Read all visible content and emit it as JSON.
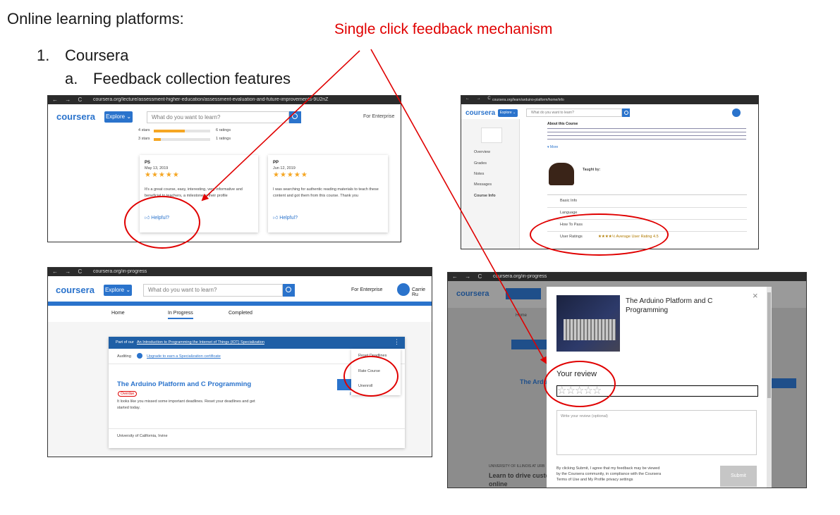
{
  "doc": {
    "title": "Online learning platforms:",
    "item1_num": "1.",
    "item1_label": "Coursera",
    "itema_num": "a.",
    "itema_label": "Feedback collection features",
    "callout": "Single click feedback mechanism"
  },
  "colors": {
    "accent": "#2a73cc",
    "annotation": "#e00000",
    "star": "#f5a623"
  },
  "shot1": {
    "url": "coursera.org/lecture/assessment-higher-education/assessment-evaluation-and-future-improvements-9U2nZ",
    "logo": "coursera",
    "explore": "Explore ⌄",
    "search_placeholder": "What do you want to learn?",
    "enterprise": "For Enterprise",
    "rating_rows": [
      {
        "label": "4 stars",
        "count": "6 ratings",
        "fill": 0.55
      },
      {
        "label": "3 stars",
        "count": "1 ratings",
        "fill": 0.12
      }
    ],
    "reviews": [
      {
        "initials": "PS",
        "date": "May 13, 2019",
        "stars": "★★★★★",
        "text": "It's a great course, easy, interesting, very informative and beneficial to teachers, a milestone in their profile",
        "helpful": "Helpful?"
      },
      {
        "initials": "PP",
        "date": "Jun 12, 2019",
        "stars": "★★★★★",
        "text": "I was searching for authentic reading materials to teach these content and got them from this course. Thank you",
        "helpful": "Helpful?"
      }
    ]
  },
  "shot2": {
    "url": "coursera.org/learn/arduino-platform/home/info",
    "logo": "coursera",
    "explore": "Explore ⌄",
    "search_placeholder": "What do you want to learn?",
    "side_items": [
      "Overview",
      "Grades",
      "Notes",
      "Messages",
      "Course Info"
    ],
    "about_title": "About this Course",
    "more": "▾ More",
    "taught_by": "Taught by:",
    "info_rows": [
      {
        "label": "Basic Info"
      },
      {
        "label": "Language"
      },
      {
        "label": "How To Pass"
      },
      {
        "label": "User Ratings",
        "value": "★★★★½  Average User Rating 4.5"
      }
    ]
  },
  "shot3": {
    "url": "coursera.org/in-progress",
    "logo": "coursera",
    "explore": "Explore ⌄",
    "search_placeholder": "What do you want to learn?",
    "enterprise": "For Enterprise",
    "user": "Carrie Ru",
    "tabs": [
      "Home",
      "In Progress",
      "Completed"
    ],
    "spec_prefix": "Part of our",
    "spec_link": "An Introduction to Programming the Internet of Things (IOT) Specialization",
    "auditing": "Auditing",
    "upgrade": "Upgrade to earn a Specialization certificate",
    "menu_items": [
      "Reset Deadlines",
      "Rate Course",
      "Unenroll"
    ],
    "course_title": "The Arduino Platform and C Programming",
    "overdue": "Overdue",
    "overdue_text": "It looks like you missed some important deadlines. Reset your deadlines and get started today.",
    "reset_link": "Reset Deadlines",
    "university": "University of California, Irvine"
  },
  "shot4": {
    "url": "coursera.org/in-progress",
    "logo": "coursera",
    "modal_title": "The Arduino Platform and C Programming",
    "your_review": "Your review",
    "stars_empty": "☆☆☆☆☆",
    "textarea_placeholder": "Write your review (optional)",
    "terms": "By clicking Submit, I agree that my feedback may be viewed by the Coursera community, in compliance with the Coursera Terms of Use and My Profile privacy settings",
    "submit": "Submit",
    "close": "×",
    "bg_university": "UNIVERSITY OF ILLINOIS AT URB",
    "bg_course": "Learn to drive custo online",
    "bg_home": "Home",
    "bg_course_short": "The Ardu"
  }
}
